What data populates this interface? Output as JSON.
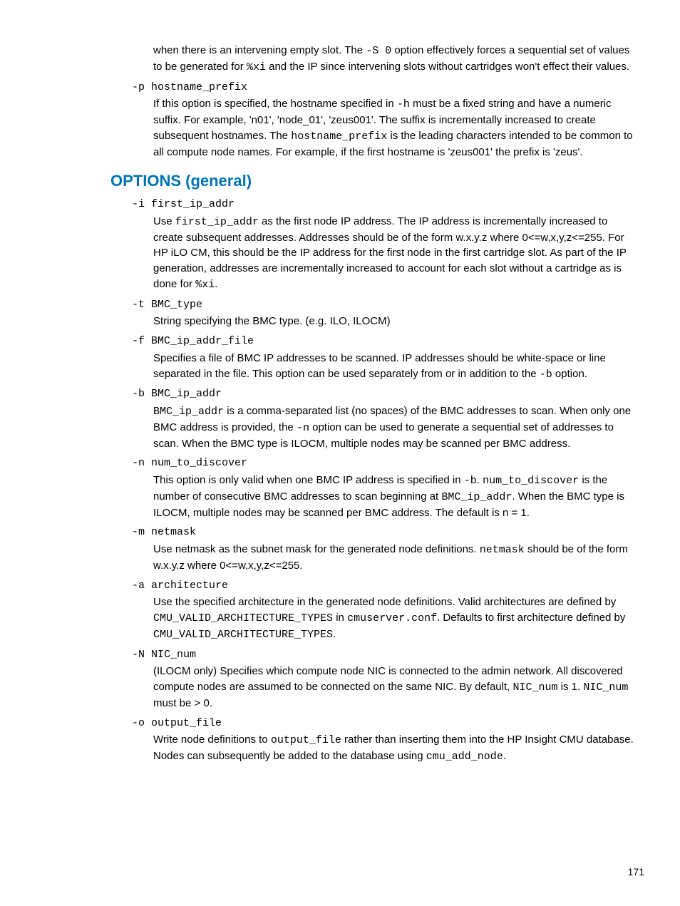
{
  "intro": {
    "p1_a": "when there is an intervening empty slot. The ",
    "p1_code1": "-S 0",
    "p1_b": " option effectively forces a sequential set of values to be generated for ",
    "p1_code2": "%xi",
    "p1_c": " and the IP since intervening slots without cartridges won't effect their values."
  },
  "opt_p": {
    "term": "-p hostname_prefix",
    "d1": "If this option is specified, the hostname specified in ",
    "d1_c1": "-h",
    "d2": " must be a fixed string and have a numeric suffix. For example, 'n01', 'node_01', 'zeus001'. The suffix is incrementally increased to create subsequent hostnames. The ",
    "d2_c1": "hostname_prefix",
    "d3": " is the leading characters intended to be common to all compute node names. For example, if the first hostname is 'zeus001' the prefix is 'zeus'."
  },
  "heading": "OPTIONS (general)",
  "opt_i": {
    "term": "-i first_ip_addr",
    "d1": "Use ",
    "d1_c1": "first_ip_addr",
    "d2": " as the first node IP address. The IP address is incrementally increased to create subsequent addresses. Addresses should be of the form w.x.y.z where 0<=w,x,y,z<=255. For HP iLO CM, this should be the IP address for the first node in the first cartridge slot. As part of the IP generation, addresses are incrementally increased to account for each slot without a cartridge as is done for ",
    "d2_c1": "%xi",
    "d3": "."
  },
  "opt_t": {
    "term": "-t BMC_type",
    "d1": "String specifying the BMC type. (e.g. ILO, ILOCM)"
  },
  "opt_f": {
    "term": "-f BMC_ip_addr_file",
    "d1": "Specifies a file of BMC IP addresses to be scanned. IP addresses should be white-space or line separated in the file. This option can be used separately from or in addition to the ",
    "d1_c1": "-b",
    "d2": " option."
  },
  "opt_b": {
    "term": "-b BMC_ip_addr",
    "d1_c1": "BMC_ip_addr",
    "d1": " is a comma-separated list (no spaces) of the BMC addresses to scan. When only one BMC address is provided, the ",
    "d1_c2": "-n",
    "d2": " option can be used to generate a sequential set of addresses to scan. When the BMC type is ILOCM, multiple nodes may be scanned per BMC address."
  },
  "opt_n": {
    "term": "-n num_to_discover",
    "d1": "This option is only valid when one BMC IP address is specified in ",
    "d1_c1": "-b",
    "d2": ". ",
    "d2_c1": "num_to_discover",
    "d3": " is the number of consecutive BMC addresses to scan beginning at ",
    "d3_c1": "BMC_ip_addr",
    "d4": ". When the BMC type is ILOCM, multiple nodes may be scanned per BMC address. The default is n = 1."
  },
  "opt_m": {
    "term": "-m netmask",
    "d1": "Use netmask as the subnet mask for the generated node definitions. ",
    "d1_c1": "netmask",
    "d2": " should be of the form w.x.y.z where 0<=w,x,y,z<=255."
  },
  "opt_a": {
    "term": "-a architecture",
    "d1": "Use the specified architecture in the generated node definitions. Valid architectures are defined by ",
    "d1_c1": "CMU_VALID_ARCHITECTURE_TYPES",
    "d2": " in ",
    "d2_c1": "cmuserver.conf",
    "d3": ". Defaults to first architecture defined by ",
    "d3_c1": "CMU_VALID_ARCHITECTURE_TYPES",
    "d4": "."
  },
  "opt_N": {
    "term": "-N NIC_num",
    "d1": "(ILOCM only) Specifies which compute node NIC is connected to the admin network. All discovered compute nodes are assumed to be connected on the same NIC. By default, ",
    "d1_c1": "NIC_num",
    "d2": " is 1. ",
    "d2_c1": "NIC_num",
    "d3": " must be > 0."
  },
  "opt_o": {
    "term": "-o output_file",
    "d1": "Write node definitions to ",
    "d1_c1": "output_file",
    "d2": " rather than inserting them into the HP Insight CMU database. Nodes can subsequently be added to the database using ",
    "d2_c1": "cmu_add_node",
    "d3": "."
  },
  "page_number": "171"
}
